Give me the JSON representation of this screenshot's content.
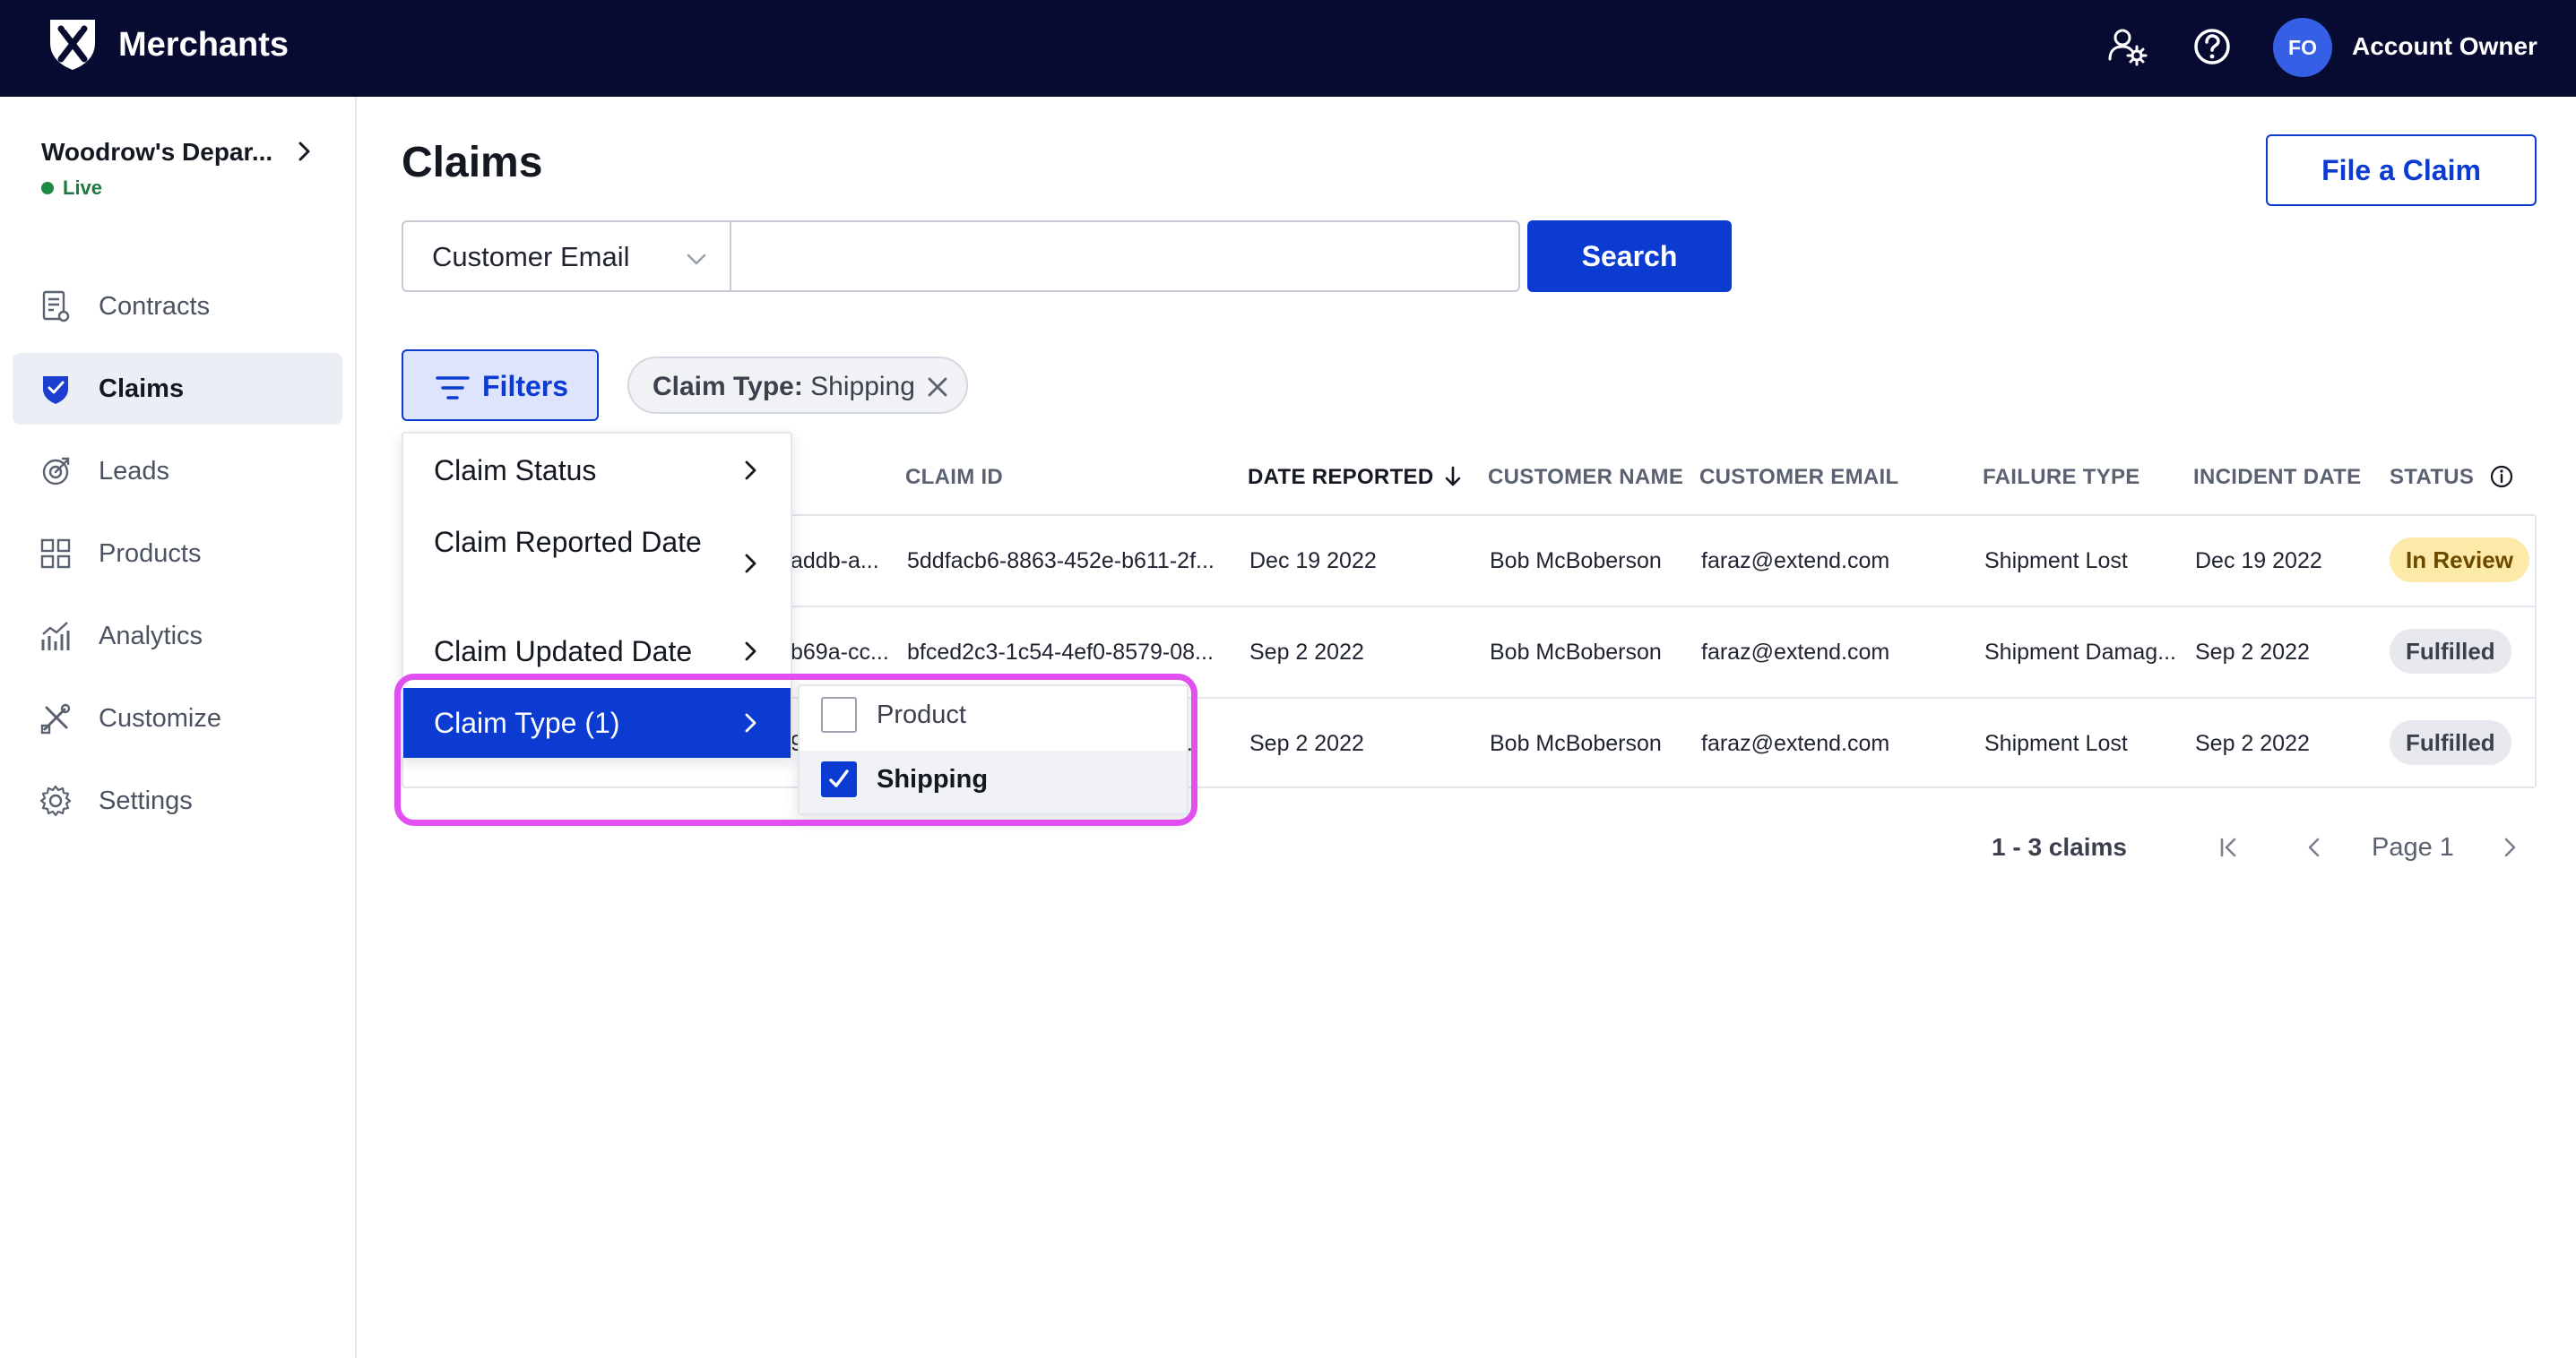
{
  "topbar": {
    "brand": "Merchants",
    "avatar_initials": "FO",
    "account_name": "Account Owner",
    "icons": [
      "x-logo-icon",
      "user-settings-icon",
      "help-icon"
    ]
  },
  "sidebar": {
    "store_name": "Woodrow's Depar...",
    "store_status": "Live",
    "items": [
      {
        "label": "Contracts",
        "icon": "contract-icon"
      },
      {
        "label": "Claims",
        "icon": "shield-icon",
        "active": true
      },
      {
        "label": "Leads",
        "icon": "leads-icon"
      },
      {
        "label": "Products",
        "icon": "grid-icon"
      },
      {
        "label": "Analytics",
        "icon": "analytics-icon"
      },
      {
        "label": "Customize",
        "icon": "tools-icon"
      },
      {
        "label": "Settings",
        "icon": "gear-icon"
      }
    ]
  },
  "main": {
    "title": "Claims",
    "file_claim_label": "File a Claim",
    "search": {
      "field_select": "Customer Email",
      "value": "",
      "button_label": "Search"
    },
    "filters_label": "Filters",
    "chip": {
      "key": "Claim Type:",
      "value": "Shipping"
    },
    "table": {
      "headers": {
        "claim_id": "CLAIM ID",
        "date_reported": "DATE REPORTED",
        "customer_name": "CUSTOMER NAME",
        "customer_email": "CUSTOMER EMAIL",
        "failure_type": "FAILURE TYPE",
        "incident_date": "INCIDENT DATE",
        "status": "STATUS"
      },
      "rows": [
        {
          "contract": "addb-a...",
          "claim_id": "5ddfacb6-8863-452e-b611-2f...",
          "date_reported": "Dec 19 2022",
          "customer_name": "Bob McBoberson",
          "customer_email": "faraz@extend.com",
          "failure_type": "Shipment Lost",
          "incident_date": "Dec 19 2022",
          "status": "In Review"
        },
        {
          "contract": "b69a-cc...",
          "claim_id": "bfced2c3-1c54-4ef0-8579-08...",
          "date_reported": "Sep 2 2022",
          "customer_name": "Bob McBoberson",
          "customer_email": "faraz@extend.com",
          "failure_type": "Shipment Damag...",
          "incident_date": "Sep 2 2022",
          "status": "Fulfilled"
        },
        {
          "contract": "9...",
          "claim_id": "...",
          "date_reported": "Sep 2 2022",
          "customer_name": "Bob McBoberson",
          "customer_email": "faraz@extend.com",
          "failure_type": "Shipment Lost",
          "incident_date": "Sep 2 2022",
          "status": "Fulfilled"
        }
      ]
    },
    "pagination": {
      "count": "1 - 3 claims",
      "page": "Page 1"
    },
    "filter_menu": {
      "items": [
        "Claim Status",
        "Claim Reported Date",
        "Claim Updated Date",
        "Claim Type (1)"
      ],
      "submenu": [
        {
          "label": "Product",
          "checked": false
        },
        {
          "label": "Shipping",
          "checked": true
        }
      ]
    }
  },
  "colors": {
    "topbar": "#070b32",
    "primary": "#0b3bd0",
    "highlight": "#e24ff0",
    "in_review": "#fde9a8",
    "fulfilled": "#e7e9ee"
  }
}
